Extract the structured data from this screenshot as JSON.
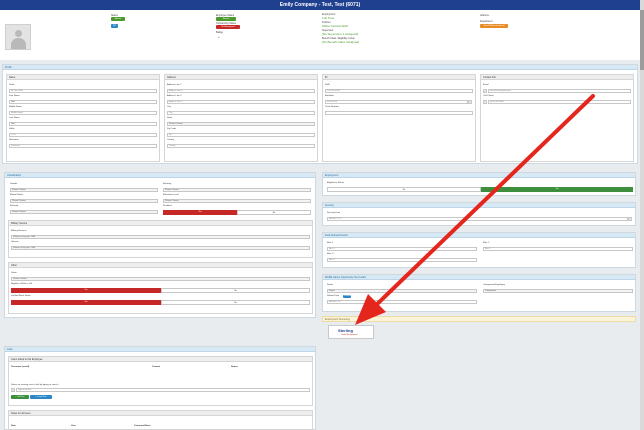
{
  "window": {
    "title": "Emily Company - Test, Test (6071)"
  },
  "header": {
    "status_label": "Status",
    "status_value": "Active",
    "status_code": "W2",
    "employee_status_label": "Employee Status",
    "employee_status_value": "Active",
    "onboarding_label": "Onboarding Status",
    "onboarding_value": "Not Assigned",
    "badge_label": "Badge",
    "employment_label": "Employment",
    "employment_value": "Full Time",
    "position_label": "Position",
    "position_value": "Office Clerical Staff",
    "supervisor_label": "Supervisor",
    "supervisor_value": "[No Supervisor 1 Assigned]",
    "benefit_label": "Benefit Class / Eligibility Group",
    "benefit_value": "[No Benefit Class Assigned]",
    "address_label": "Address",
    "department_label": "Department",
    "action_button": "Send Welcome Email"
  },
  "sections": {
    "profile": "Profile",
    "classification": "Classification",
    "employment": "Employment",
    "security": "Security",
    "links": "Links",
    "eeo": "EEO Information",
    "custom_fields": "Field Defined/Custom",
    "more": "MORE Labour Opportunity Tax Credits",
    "document": "Employment Screening"
  },
  "name_card": {
    "title": "Name",
    "prefix_label": "Prefix",
    "prefix_value": "Mr, Mrs, Miss",
    "first_label": "First Name",
    "first_value": "Test",
    "middle_label": "Middle Name",
    "middle_value": "Middle Name",
    "last_label": "Last Name",
    "last_value": "Test",
    "suffix_label": "Suffix",
    "suffix_value": "Jr, Sr",
    "nickname_label": "Nickname",
    "nickname_value": "Nickname"
  },
  "address_card": {
    "title": "Address",
    "line1_label": "Address Line 1",
    "line1_value": "Address Line 1",
    "line2_label": "Address Line 2",
    "line2_value": "Address Line 2",
    "city_label": "City",
    "city_value": "City",
    "state_label": "State",
    "state_value": "Please Choose",
    "zip_label": "Zip Code",
    "zip_value": "Zip",
    "county_label": "County",
    "county_value": "County"
  },
  "id_card": {
    "title": "ID",
    "ssn_label": "SSN",
    "ssn_value": "XXX-XX-4568",
    "birthdate_label": "Birthdate",
    "birthdate_value": "01/01/1990",
    "clock_label": "Clock Number",
    "clock_value": ""
  },
  "contact_card": {
    "title": "Contact Info",
    "email_label": "Email",
    "email_value": "test@testcompany.com",
    "cell_label": "Cell Phone",
    "cell_value": "(000) 000-0000"
  },
  "classification": {
    "gender_label": "Gender",
    "gender_value": "Please Choose",
    "marital_label": "Marital Status",
    "marital_value": "Please Choose",
    "ethnicity_label": "Ethnicity",
    "ethnicity_value": "Please Choose",
    "military_title": "Military Service",
    "military_label": "Military Reserve",
    "military_value": "Veteran of any war - N/A",
    "veteran_label": "Veteran",
    "veteran_value": "Veteran of any war - N/A",
    "other_title": "Other",
    "union_label": "Union",
    "union_value": "Please Choose",
    "eligible_label": "Eligible to Work in US",
    "eligible_yes": "Yes",
    "eligible_no": "No",
    "verified_label": "Verified Work Status",
    "verified_yes": "Yes",
    "verified_no": "No",
    "ethnicity2_label": "Ethnicity",
    "ethnicity2_value": "Please Choose",
    "education_label": "Education Level",
    "education_value": "Please Choose",
    "disabled_label": "Disabled",
    "disabled_yes": "Yes",
    "disabled_no": "No"
  },
  "employment": {
    "eligible_label": "Eligible for Rehire",
    "no": "No",
    "yes": "Yes",
    "security_date_label": "Security Date",
    "security_date_value": "MM/DD/YYYY"
  },
  "custom": {
    "m1": "Misc 1",
    "m2": "Misc 2",
    "m3": "Misc 3",
    "m1v": "Misc 1",
    "m2v": "Misc 2",
    "m3v": "Misc 3"
  },
  "more": {
    "status_label": "Status",
    "status_value": "Status",
    "cert_label": "Certification",
    "cert_value": "Certification",
    "submit_label": "Submit Date",
    "submit_badge": "Submit",
    "submit_value": "MM/DD/YYYY",
    "categorized_label": "Categorized Employee",
    "categorized_value": "Categorized"
  },
  "links": {
    "upload_title": "Users linked to this Employee",
    "username_col": "Username (email)",
    "contact_col": "Contact",
    "status_col": "Status",
    "link_label": "Select an existing user to link by typing to search",
    "link_placeholder": "Type to search",
    "add_button": "+ Link User",
    "new_button": "+ Create User",
    "notes_title": "Notes for all Users",
    "date_col": "Date",
    "user_col": "User",
    "note_col": "Comment/Notes"
  },
  "document_logo": {
    "text": "Sterling",
    "caption": "Order Background"
  },
  "colors": {
    "title_bar": "#1f3f8f",
    "accent_green": "#3d8f3d",
    "accent_red": "#c62828",
    "arrow_red": "#e5261d",
    "section_header": "#d6e9f5"
  }
}
